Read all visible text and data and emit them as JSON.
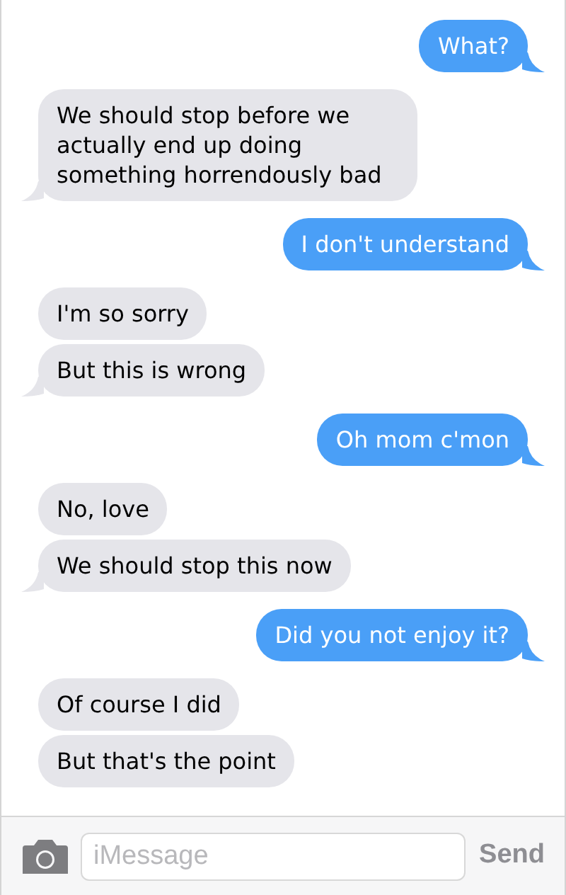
{
  "messages": [
    {
      "kind": "outgoing",
      "text": "What?",
      "tail": true
    },
    {
      "kind": "incoming",
      "text": "We should stop before we actually end up doing something horrendously bad",
      "tail": true
    },
    {
      "kind": "outgoing",
      "text": "I don't understand",
      "tail": true
    },
    {
      "kind": "incoming",
      "text": "I'm so sorry",
      "tail": false
    },
    {
      "kind": "incoming",
      "text": "But this is wrong",
      "tail": true
    },
    {
      "kind": "outgoing",
      "text": "Oh mom c'mon",
      "tail": true
    },
    {
      "kind": "incoming",
      "text": "No, love",
      "tail": false
    },
    {
      "kind": "incoming",
      "text": "We should stop this now",
      "tail": true
    },
    {
      "kind": "outgoing",
      "text": "Did you not enjoy it?",
      "tail": true
    },
    {
      "kind": "incoming",
      "text": "Of course I did",
      "tail": false
    },
    {
      "kind": "incoming",
      "text": "But that's the point",
      "tail": false
    }
  ],
  "composer": {
    "placeholder": "iMessage",
    "send": "Send"
  }
}
